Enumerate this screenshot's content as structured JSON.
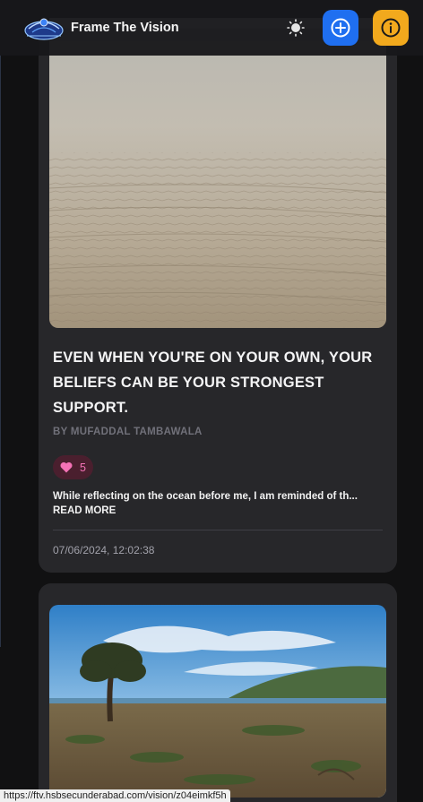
{
  "header": {
    "brand": "Frame The Vision",
    "theme_icon": "sun-icon",
    "add_icon": "plus-circle-icon",
    "info_icon": "info-icon",
    "colors": {
      "add": "#1f6ff0",
      "info": "#f2a91d"
    }
  },
  "posts": [
    {
      "title": "EVEN WHEN YOU'RE ON YOUR OWN, YOUR BELIEFS CAN BE YOUR STRONGEST SUPPORT.",
      "by_prefix": "BY",
      "author": "MUFADDAL TAMBAWALA",
      "likes": "5",
      "excerpt": "While reflecting on the ocean before me, I am reminded of th...",
      "read_more": "READ MORE",
      "date": "07/06/2024, 12:02:38"
    }
  ],
  "statusbar": {
    "url": "https://ftv.hsbsecunderabad.com/vision/z04eimkf5h"
  }
}
